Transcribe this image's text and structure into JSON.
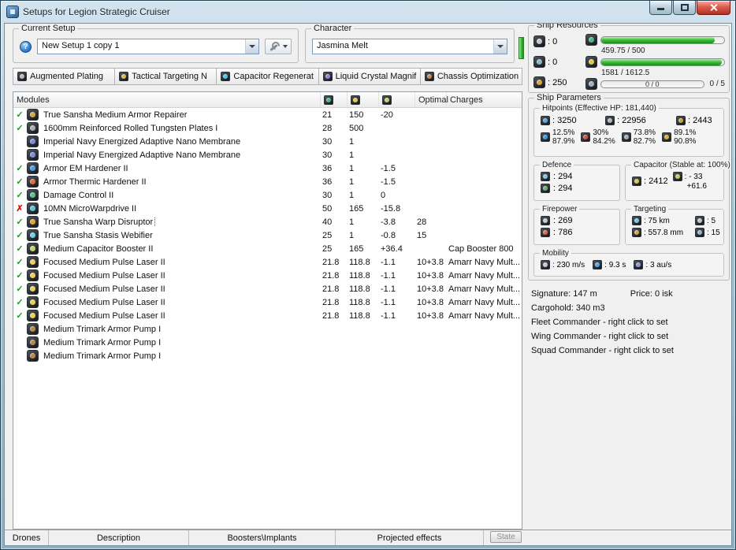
{
  "window": {
    "title": "Setups for Legion Strategic Cruiser"
  },
  "setup": {
    "label": "Current Setup",
    "value": "New Setup 1 copy 1"
  },
  "character": {
    "label": "Character",
    "value": "Jasmina Melt"
  },
  "ship_resources": {
    "title": "Ship Resources",
    "turrets": ": 0",
    "launchers": ": 0",
    "calibration": ": 250",
    "cpu_text": "459.75 / 500",
    "cpu_pct": 92,
    "powergrid_text": "1581 / 1612.5",
    "powergrid_pct": 98,
    "drone_text": "0 / 0",
    "drone_pct": 0,
    "upgrades_text": "0 / 5"
  },
  "subsystems": {
    "tabs": [
      {
        "label": "Augmented Plating"
      },
      {
        "label": "Tactical Targeting N"
      },
      {
        "label": "Capacitor Regenerat"
      },
      {
        "label": "Liquid Crystal Magnif"
      },
      {
        "label": "Chassis Optimization"
      }
    ]
  },
  "modules": {
    "header": {
      "name": "Modules",
      "optimal": "Optimal",
      "charges": "Charges"
    },
    "rows": [
      {
        "status": "ok",
        "icon": "armor-repairer",
        "name": "True Sansha Medium Armor Repairer",
        "cpu": "21",
        "pg": "150",
        "cap": "-20",
        "optimal": "",
        "charges": ""
      },
      {
        "status": "ok",
        "icon": "armor-plate",
        "name": "1600mm Reinforced Rolled Tungsten Plates I",
        "cpu": "28",
        "pg": "500",
        "cap": "",
        "optimal": "",
        "charges": ""
      },
      {
        "status": "none",
        "icon": "nano-membrane",
        "name": "Imperial Navy Energized Adaptive Nano Membrane",
        "cpu": "30",
        "pg": "1",
        "cap": "",
        "optimal": "",
        "charges": ""
      },
      {
        "status": "none",
        "icon": "nano-membrane",
        "name": "Imperial Navy Energized Adaptive Nano Membrane",
        "cpu": "30",
        "pg": "1",
        "cap": "",
        "optimal": "",
        "charges": ""
      },
      {
        "status": "ok",
        "icon": "em-hardener",
        "name": "Armor EM Hardener II",
        "cpu": "36",
        "pg": "1",
        "cap": "-1.5",
        "optimal": "",
        "charges": ""
      },
      {
        "status": "ok",
        "icon": "thermic-hardener",
        "name": "Armor Thermic Hardener II",
        "cpu": "36",
        "pg": "1",
        "cap": "-1.5",
        "optimal": "",
        "charges": ""
      },
      {
        "status": "ok",
        "icon": "damage-control",
        "name": "Damage Control II",
        "cpu": "30",
        "pg": "1",
        "cap": "0",
        "optimal": "",
        "charges": ""
      },
      {
        "status": "bad",
        "icon": "microwarpdrive",
        "name": "10MN MicroWarpdrive II",
        "cpu": "50",
        "pg": "165",
        "cap": "-15.8",
        "optimal": "",
        "charges": ""
      },
      {
        "status": "ok",
        "icon": "warp-disruptor",
        "name": "True Sansha Warp Disruptor",
        "cpu": "40",
        "pg": "1",
        "cap": "-3.8",
        "optimal": "28",
        "charges": "",
        "selected": true
      },
      {
        "status": "ok",
        "icon": "stasis-webifier",
        "name": "True Sansha Stasis Webifier",
        "cpu": "25",
        "pg": "1",
        "cap": "-0.8",
        "optimal": "15",
        "charges": ""
      },
      {
        "status": "ok",
        "icon": "capacitor-booster",
        "name": "Medium Capacitor Booster II",
        "cpu": "25",
        "pg": "165",
        "cap": "+36.4",
        "optimal": "",
        "charges": "Cap Booster 800"
      },
      {
        "status": "ok",
        "icon": "pulse-laser",
        "name": "Focused Medium Pulse Laser II",
        "cpu": "21.8",
        "pg": "118.8",
        "cap": "-1.1",
        "optimal": "10+3.8",
        "charges": "Amarr Navy Mult..."
      },
      {
        "status": "ok",
        "icon": "pulse-laser",
        "name": "Focused Medium Pulse Laser II",
        "cpu": "21.8",
        "pg": "118.8",
        "cap": "-1.1",
        "optimal": "10+3.8",
        "charges": "Amarr Navy Mult..."
      },
      {
        "status": "ok",
        "icon": "pulse-laser",
        "name": "Focused Medium Pulse Laser II",
        "cpu": "21.8",
        "pg": "118.8",
        "cap": "-1.1",
        "optimal": "10+3.8",
        "charges": "Amarr Navy Mult..."
      },
      {
        "status": "ok",
        "icon": "pulse-laser",
        "name": "Focused Medium Pulse Laser II",
        "cpu": "21.8",
        "pg": "118.8",
        "cap": "-1.1",
        "optimal": "10+3.8",
        "charges": "Amarr Navy Mult..."
      },
      {
        "status": "ok",
        "icon": "pulse-laser",
        "name": "Focused Medium Pulse Laser II",
        "cpu": "21.8",
        "pg": "118.8",
        "cap": "-1.1",
        "optimal": "10+3.8",
        "charges": "Amarr Navy Mult..."
      },
      {
        "status": "none",
        "icon": "armor-rig",
        "name": "Medium Trimark Armor Pump I",
        "cpu": "",
        "pg": "",
        "cap": "",
        "optimal": "",
        "charges": ""
      },
      {
        "status": "none",
        "icon": "armor-rig",
        "name": "Medium Trimark Armor Pump I",
        "cpu": "",
        "pg": "",
        "cap": "",
        "optimal": "",
        "charges": ""
      },
      {
        "status": "none",
        "icon": "armor-rig",
        "name": "Medium Trimark Armor Pump I",
        "cpu": "",
        "pg": "",
        "cap": "",
        "optimal": "",
        "charges": ""
      }
    ]
  },
  "parameters": {
    "title": "Ship Parameters",
    "hitpoints": {
      "title": "Hitpoints (Effective HP: 181,440)",
      "shield": ": 3250",
      "armor": ": 22956",
      "structure": ": 2443",
      "resists": [
        {
          "shield_pct": "12.5%",
          "armor_pct": "87.9%"
        },
        {
          "shield_pct": "30%",
          "armor_pct": "84.2%"
        },
        {
          "shield_pct": "73.8%",
          "armor_pct": "82.7%"
        },
        {
          "shield_pct": "89.1%",
          "armor_pct": "90.8%"
        }
      ]
    },
    "defence": {
      "title": "Defence",
      "top": ": 294",
      "bottom": ": 294"
    },
    "capacitor": {
      "title": "Capacitor (Stable at: 100%)",
      "amount": ": 2412",
      "drain": ": - 33",
      "recharge": "+61.6"
    },
    "firepower": {
      "title": "Firepower",
      "volley": ": 269",
      "dps": ": 786"
    },
    "targeting": {
      "title": "Targeting",
      "range": ": 75 km",
      "max_targets": ": 5",
      "scan_resolution": ": 557.8 mm",
      "sensor_strength": ": 15"
    },
    "mobility": {
      "title": "Mobility",
      "speed": ": 230 m/s",
      "align_time": ": 9.3 s",
      "warp_speed": ": 3 au/s"
    },
    "signature": "Signature: 147 m",
    "price": "Price: 0 isk",
    "cargohold": "Cargohold: 340 m3",
    "fleet_commander": "Fleet Commander - right click to set",
    "wing_commander": "Wing Commander - right click to set",
    "squad_commander": "Squad Commander - right click to set"
  },
  "bottom_tabs": [
    {
      "label": "Drones"
    },
    {
      "label": "Description"
    },
    {
      "label": "Boosters\\Implants"
    },
    {
      "label": "Projected effects"
    }
  ],
  "state_button": "State"
}
